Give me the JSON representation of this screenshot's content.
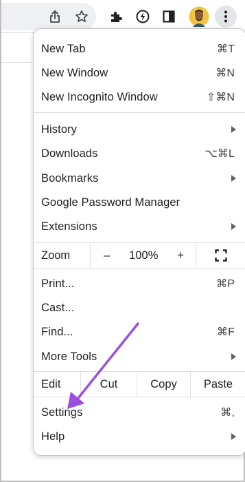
{
  "toolbar": {
    "icons": [
      "share-icon",
      "star-icon",
      "puzzle-icon",
      "lightning-icon",
      "side-panel-icon",
      "avatar",
      "three-dots-icon"
    ]
  },
  "menu": {
    "new_tab": {
      "label": "New Tab",
      "shortcut": "⌘T"
    },
    "new_window": {
      "label": "New Window",
      "shortcut": "⌘N"
    },
    "new_incognito": {
      "label": "New Incognito Window",
      "shortcut": "⇧⌘N"
    },
    "history": {
      "label": "History"
    },
    "downloads": {
      "label": "Downloads",
      "shortcut": "⌥⌘L"
    },
    "bookmarks": {
      "label": "Bookmarks"
    },
    "password_manager": {
      "label": "Google Password Manager"
    },
    "extensions": {
      "label": "Extensions"
    },
    "zoom": {
      "label": "Zoom",
      "minus": "–",
      "value": "100%",
      "plus": "+"
    },
    "print": {
      "label": "Print...",
      "shortcut": "⌘P"
    },
    "cast": {
      "label": "Cast..."
    },
    "find": {
      "label": "Find...",
      "shortcut": "⌘F"
    },
    "more_tools": {
      "label": "More Tools"
    },
    "edit": {
      "label": "Edit",
      "cut": "Cut",
      "copy": "Copy",
      "paste": "Paste"
    },
    "settings": {
      "label": "Settings",
      "shortcut": "⌘,"
    },
    "help": {
      "label": "Help"
    }
  },
  "annotation": {
    "color": "#9b4fe0"
  },
  "colors": {
    "menu_button_bg": "#e3e5e8",
    "menu_border": "#c7c7c7",
    "separator": "#dedede"
  }
}
